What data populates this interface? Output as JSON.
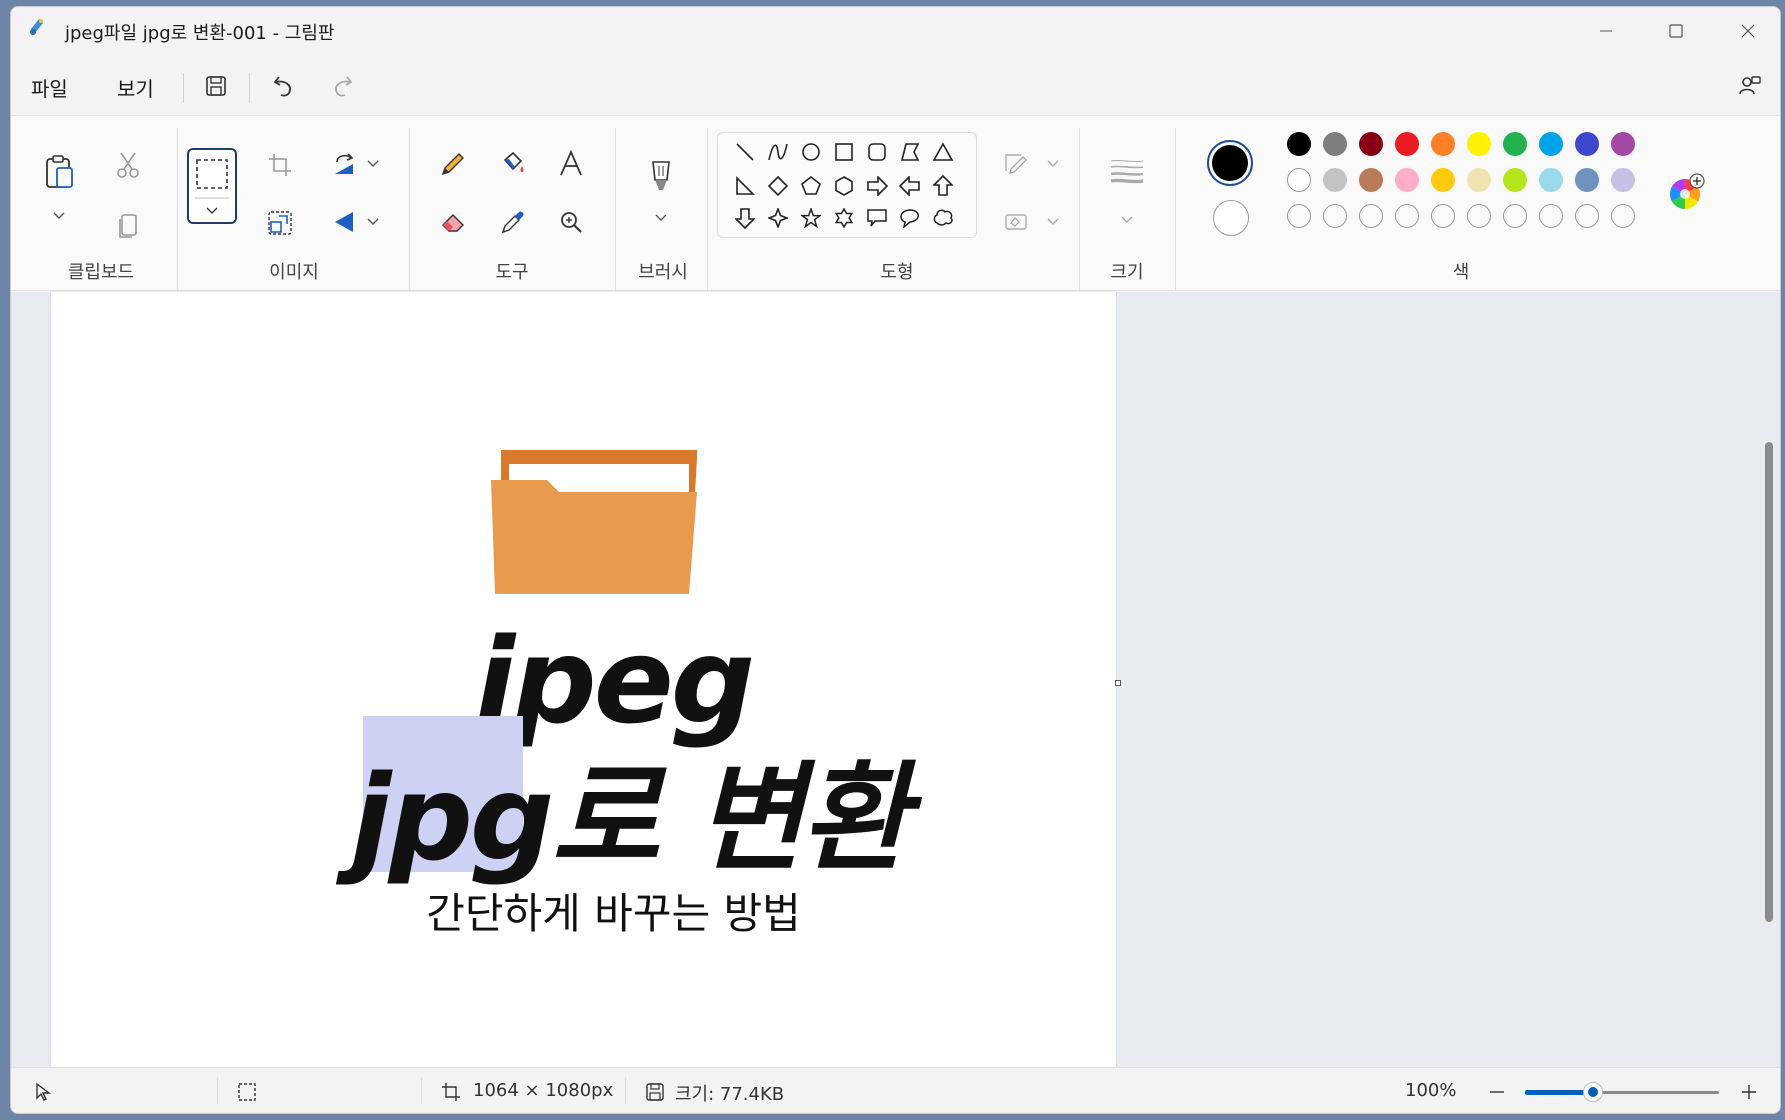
{
  "window": {
    "title": "jpeg파일 jpg로 변환-001 - 그림판"
  },
  "menu": {
    "file": "파일",
    "view": "보기"
  },
  "ribbon": {
    "groups": {
      "clipboard": "클립보드",
      "image": "이미지",
      "tools": "도구",
      "brushes": "브러시",
      "shapes": "도형",
      "size": "크기",
      "colors": "색"
    }
  },
  "colors": {
    "primary": "#000000",
    "secondary": "#ffffff",
    "palette_row1": [
      "#000000",
      "#7f7f7f",
      "#880015",
      "#ed1c24",
      "#ff7f27",
      "#fff200",
      "#22b14c",
      "#00a2e8",
      "#3f48cc",
      "#a349a4"
    ],
    "palette_row2": [
      "#ffffff",
      "#c3c3c3",
      "#b97a57",
      "#ffaec9",
      "#ffc90e",
      "#efe4b0",
      "#b5e61d",
      "#99d9ea",
      "#7092be",
      "#c8bfe7"
    ],
    "accent": "#005fb8"
  },
  "canvas_art": {
    "line1": "jpeg",
    "line2": "jpg로 변환",
    "subtitle": "간단하게 바꾸는 방법",
    "folder_color": "#e89b4f",
    "highlight_color": "#cdd1f3"
  },
  "status": {
    "dimensions": "1064 × 1080px",
    "file_size": "크기: 77.4KB",
    "zoom": "100%",
    "zoom_level": 0.35
  }
}
